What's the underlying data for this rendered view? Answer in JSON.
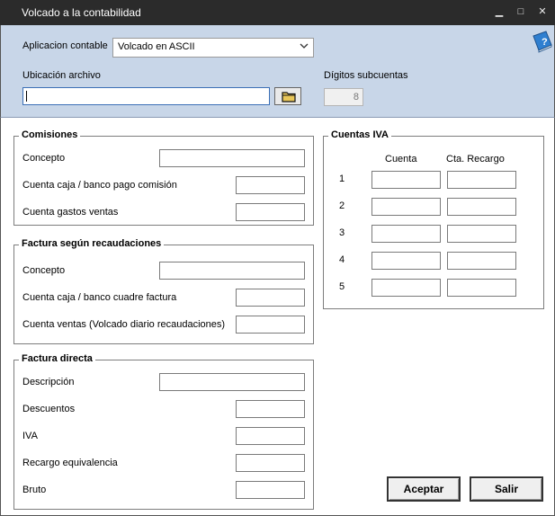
{
  "window": {
    "title": "Volcado a la contabilidad",
    "minimize_glyph": "▁",
    "maximize_glyph": "□",
    "close_glyph": "✕"
  },
  "header": {
    "aplicacion_label": "Aplicacion contable",
    "aplicacion_value": "Volcado en ASCII",
    "ubicacion_label": "Ubicación archivo",
    "ubicacion_value": "",
    "digitos_label": "Dígitos subcuentas",
    "digitos_value": "8",
    "help_icon": "help-book-icon",
    "folder_icon": "folder-icon"
  },
  "comisiones": {
    "title": "Comisiones",
    "concepto_label": "Concepto",
    "concepto_value": "",
    "caja_label": "Cuenta caja / banco pago comisión",
    "caja_value": "",
    "gastos_label": "Cuenta gastos ventas",
    "gastos_value": ""
  },
  "factura_recaudaciones": {
    "title": "Factura según recaudaciones",
    "concepto_label": "Concepto",
    "concepto_value": "",
    "caja_label": "Cuenta caja / banco cuadre factura",
    "caja_value": "",
    "ventas_label": "Cuenta ventas (Volcado diario recaudaciones)",
    "ventas_value": ""
  },
  "factura_directa": {
    "title": "Factura directa",
    "descripcion_label": "Descripción",
    "descripcion_value": "",
    "descuentos_label": "Descuentos",
    "descuentos_value": "",
    "iva_label": "IVA",
    "iva_value": "",
    "recargo_label": "Recargo equivalencia",
    "recargo_value": "",
    "bruto_label": "Bruto",
    "bruto_value": ""
  },
  "cuentas_iva": {
    "title": "Cuentas IVA",
    "col_cuenta": "Cuenta",
    "col_recargo": "Cta. Recargo",
    "rows": [
      {
        "num": "1",
        "cuenta": "",
        "recargo": ""
      },
      {
        "num": "2",
        "cuenta": "",
        "recargo": ""
      },
      {
        "num": "3",
        "cuenta": "",
        "recargo": ""
      },
      {
        "num": "4",
        "cuenta": "",
        "recargo": ""
      },
      {
        "num": "5",
        "cuenta": "",
        "recargo": ""
      }
    ]
  },
  "buttons": {
    "aceptar": "Aceptar",
    "salir": "Salir"
  },
  "colors": {
    "titlebar": "#2b2b2b",
    "header_bg": "#c8d6e8",
    "focus_border": "#3b6fb6"
  }
}
